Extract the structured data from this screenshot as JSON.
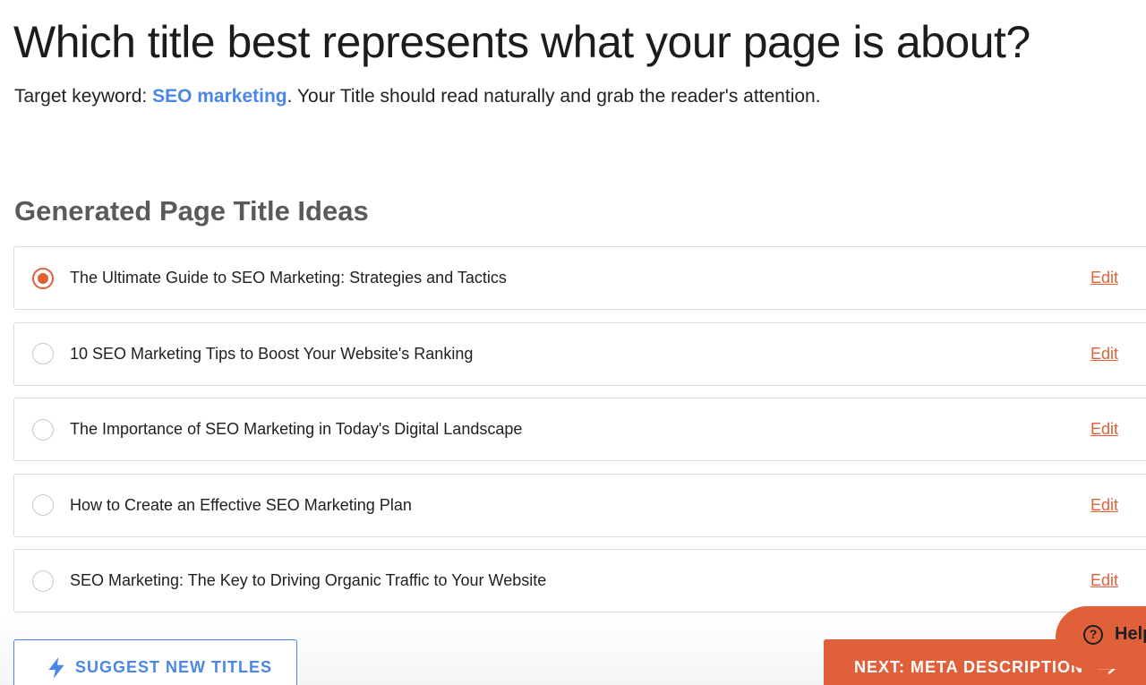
{
  "heading": {
    "title": "Which title best represents what your page is about?",
    "subtitle_prefix": "Target keyword: ",
    "keyword": "SEO marketing",
    "subtitle_suffix": ". Your Title should read naturally and grab the reader's attention."
  },
  "section": {
    "title": "Generated Page Title Ideas"
  },
  "title_options": [
    {
      "label": "The Ultimate Guide to SEO Marketing: Strategies and Tactics",
      "selected": true,
      "edit_label": "Edit"
    },
    {
      "label": "10 SEO Marketing Tips to Boost Your Website's Ranking",
      "selected": false,
      "edit_label": "Edit"
    },
    {
      "label": "The Importance of SEO Marketing in Today's Digital Landscape",
      "selected": false,
      "edit_label": "Edit"
    },
    {
      "label": "How to Create an Effective SEO Marketing Plan",
      "selected": false,
      "edit_label": "Edit"
    },
    {
      "label": "SEO Marketing: The Key to Driving Organic Traffic to Your Website",
      "selected": false,
      "edit_label": "Edit"
    }
  ],
  "actions": {
    "suggest_label": "SUGGEST NEW TITLES",
    "next_label": "NEXT: META DESCRIPTION",
    "help_label": "Help"
  },
  "colors": {
    "accent_orange": "#e0603a",
    "accent_blue": "#4a86e8",
    "border": "#dcdcdc"
  },
  "icons": {
    "suggest": "lightning-bolt-icon",
    "next": "arrow-right-icon",
    "help": "question-circle-icon"
  }
}
